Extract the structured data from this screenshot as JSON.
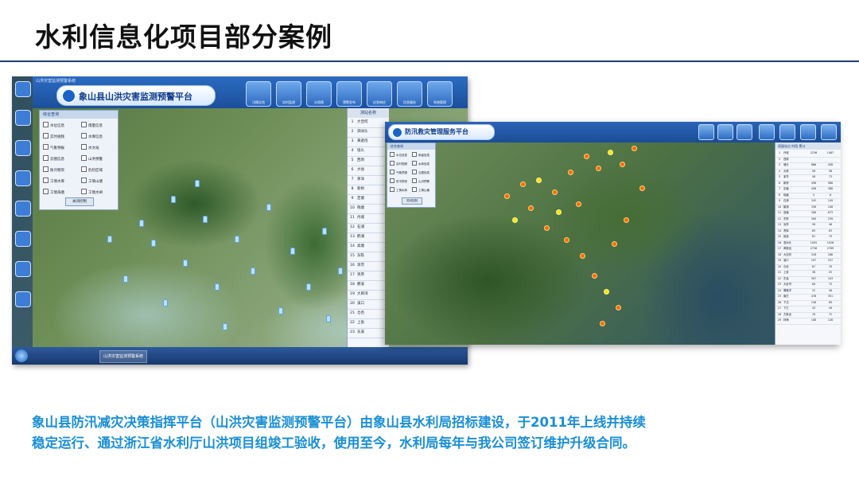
{
  "slide": {
    "title": "水利信息化项目部分案例",
    "caption_line1": "象山县防汛减灾决策指挥平台（山洪灾害监测预警平台）由象山县水利局招标建设，于2011年上线并持续",
    "caption_line2": "稳定运行、通过浙江省水利厅山洪项目组竣工验收，使用至今，水利局每年与我公司签订维护升级合同。"
  },
  "screenshot1": {
    "window_title": "山洪灾害监测预警系统",
    "app_title": "象山县山洪灾害监测预警平台",
    "toolbar": [
      "汛情总览",
      "实时监测",
      "水雨情",
      "预警发布",
      "应急响应",
      "信息服务",
      "系统管理"
    ],
    "panel": {
      "title": "综合查询",
      "items": [
        "水位信息",
        "雨量信息",
        "实时视频",
        "水库信息",
        "气象预报",
        "水文站",
        "云图信息",
        "山洪预警",
        "防汛物资",
        "危险区域",
        "工情水库",
        "工情山塘",
        "工情海塘",
        "工情水闸"
      ],
      "button": "关闭控制"
    },
    "list": {
      "header": "测站名称",
      "rows": [
        {
          "no": "1",
          "name": "大佳何"
        },
        {
          "no": "2",
          "name": "泗洲头"
        },
        {
          "no": "3",
          "name": "黄避岙"
        },
        {
          "no": "4",
          "name": "墙头"
        },
        {
          "no": "5",
          "name": "西周"
        },
        {
          "no": "6",
          "name": "大徐"
        },
        {
          "no": "7",
          "name": "茅洋"
        },
        {
          "no": "8",
          "name": "新桥"
        },
        {
          "no": "9",
          "name": "定塘"
        },
        {
          "no": "10",
          "name": "晓塘"
        },
        {
          "no": "11",
          "name": "丹城"
        },
        {
          "no": "12",
          "name": "石浦"
        },
        {
          "no": "13",
          "name": "鹤浦"
        },
        {
          "no": "14",
          "name": "高塘"
        },
        {
          "no": "15",
          "name": "东陈"
        },
        {
          "no": "16",
          "name": "涂茨"
        },
        {
          "no": "17",
          "name": "贤庠"
        },
        {
          "no": "18",
          "name": "爵溪"
        },
        {
          "no": "19",
          "name": "大目湾"
        },
        {
          "no": "20",
          "name": "溪口"
        },
        {
          "no": "21",
          "name": "仓岙"
        },
        {
          "no": "22",
          "name": "上张"
        },
        {
          "no": "23",
          "name": "东溪"
        }
      ]
    },
    "taskbar_items": [
      "山洪灾害监测预警系统"
    ]
  },
  "screenshot2": {
    "app_title": "防汛救灾管理服务平台",
    "panel": {
      "title": "综合查询",
      "items": [
        "水位信息",
        "雨量信息",
        "实时视频",
        "水库信息",
        "气象预报",
        "云图信息",
        "防汛物资",
        "山洪预警",
        "工情水库",
        "工情山塘"
      ],
      "button": "关闭控制"
    },
    "table": {
      "header": "雨量站点  时段  累计",
      "rows": [
        {
          "no": "1",
          "name": "丹城",
          "a": "2236",
          "b": "1467"
        },
        {
          "no": "2",
          "name": "西周",
          "a": "",
          "b": ""
        },
        {
          "no": "3",
          "name": "墙头",
          "a": "866",
          "b": "458"
        },
        {
          "no": "4",
          "name": "大徐",
          "a": "58",
          "b": "56"
        },
        {
          "no": "5",
          "name": "茅洋",
          "a": "48",
          "b": "73"
        },
        {
          "no": "6",
          "name": "新桥",
          "a": "498",
          "b": "988"
        },
        {
          "no": "7",
          "name": "定塘",
          "a": "458",
          "b": "388"
        },
        {
          "no": "8",
          "name": "晓塘",
          "a": "5",
          "b": "6"
        },
        {
          "no": "9",
          "name": "石浦",
          "a": "342",
          "b": "149"
        },
        {
          "no": "10",
          "name": "鹤浦",
          "a": "338",
          "b": "248"
        },
        {
          "no": "11",
          "name": "高塘",
          "a": "508",
          "b": "673"
        },
        {
          "no": "12",
          "name": "东陈",
          "a": "309",
          "b": "239"
        },
        {
          "no": "13",
          "name": "涂茨",
          "a": "58",
          "b": "46"
        },
        {
          "no": "14",
          "name": "贤庠",
          "a": "63",
          "b": "83"
        },
        {
          "no": "15",
          "name": "爵溪",
          "a": "81",
          "b": "79"
        },
        {
          "no": "16",
          "name": "泗洲头",
          "a": "1095",
          "b": "1026"
        },
        {
          "no": "17",
          "name": "黄避岙",
          "a": "2736",
          "b": "2789"
        },
        {
          "no": "18",
          "name": "大佳何",
          "a": "328",
          "b": "286"
        },
        {
          "no": "19",
          "name": "溪口",
          "a": "197",
          "b": "537"
        },
        {
          "no": "20",
          "name": "仓岙",
          "a": "67",
          "b": "70"
        },
        {
          "no": "21",
          "name": "上张",
          "a": "38",
          "b": "55"
        },
        {
          "no": "22",
          "name": "东溪",
          "a": "307",
          "b": "103"
        },
        {
          "no": "23",
          "name": "大目湾",
          "a": "69",
          "b": "75"
        },
        {
          "no": "24",
          "name": "儒雅洋",
          "a": "32",
          "b": "48"
        },
        {
          "no": "25",
          "name": "南庄",
          "a": "476",
          "b": "351"
        },
        {
          "no": "26",
          "name": "下沈",
          "a": "158",
          "b": "89"
        },
        {
          "no": "27",
          "name": "下王",
          "a": "43",
          "b": "49"
        },
        {
          "no": "28",
          "name": "方家岙",
          "a": "78",
          "b": "72"
        },
        {
          "no": "29",
          "name": "林海",
          "a": "108",
          "b": "126"
        }
      ]
    }
  }
}
